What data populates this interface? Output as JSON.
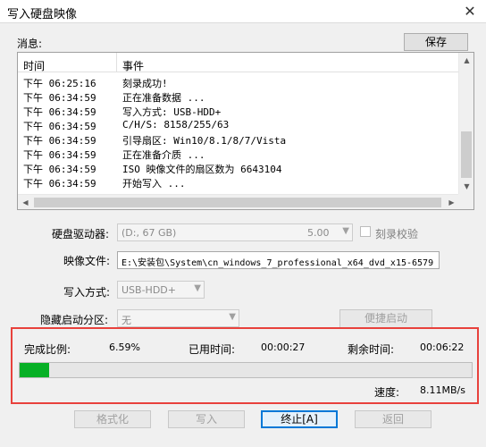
{
  "window": {
    "title": "写入硬盘映像"
  },
  "messages": {
    "label": "消息:",
    "save_button": "保存",
    "columns": {
      "time": "时间",
      "event": "事件"
    },
    "rows": [
      {
        "time": "下午 06:25:16",
        "event": "刻录成功!"
      },
      {
        "time": "下午 06:34:59",
        "event": "正在准备数据 ..."
      },
      {
        "time": "下午 06:34:59",
        "event": "写入方式: USB-HDD+"
      },
      {
        "time": "下午 06:34:59",
        "event": "C/H/S: 8158/255/63"
      },
      {
        "time": "下午 06:34:59",
        "event": "引导扇区: Win10/8.1/8/7/Vista"
      },
      {
        "time": "下午 06:34:59",
        "event": "正在准备介质 ..."
      },
      {
        "time": "下午 06:34:59",
        "event": "ISO 映像文件的扇区数为 6643104"
      },
      {
        "time": "下午 06:34:59",
        "event": "开始写入 ..."
      }
    ]
  },
  "drive": {
    "label": "硬盘驱动器:",
    "value": "(D:, 67 GB)",
    "size": "5.00",
    "verify_label": "刻录校验"
  },
  "image_file": {
    "label": "映像文件:",
    "value": "E:\\安装包\\System\\cn_windows_7_professional_x64_dvd_x15-6579"
  },
  "write_method": {
    "label": "写入方式:",
    "value": "USB-HDD+"
  },
  "hidden_partition": {
    "label": "隐藏启动分区:",
    "value": "无"
  },
  "quick_boot_button": "便捷启动",
  "status": {
    "percent_label": "完成比例:",
    "percent_value": "6.59%",
    "progress_fraction": 0.0659,
    "elapsed_label": "已用时间:",
    "elapsed_value": "00:00:27",
    "remaining_label": "剩余时间:",
    "remaining_value": "00:06:22",
    "speed_label": "速度:",
    "speed_value": "8.11MB/s"
  },
  "buttons": {
    "format": "格式化",
    "write": "写入",
    "abort": "终止[A]",
    "return": "返回"
  },
  "colors": {
    "progress_fill": "#06b025",
    "highlight_border": "#e8413c",
    "focus_border": "#0078d7"
  }
}
